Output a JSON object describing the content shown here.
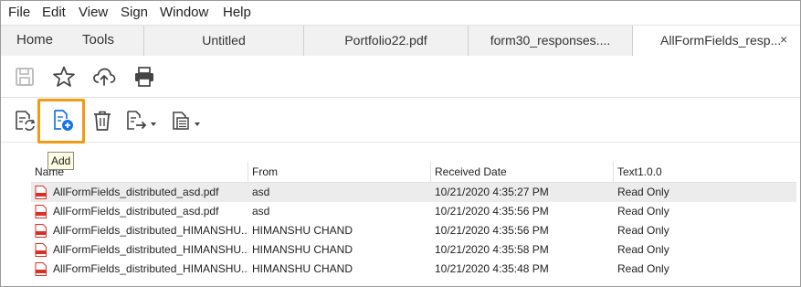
{
  "menu": [
    "File",
    "Edit",
    "View",
    "Sign",
    "Window",
    "Help"
  ],
  "tabs": {
    "home": "Home",
    "tools": "Tools",
    "documents": [
      "Untitled",
      "Portfolio22.pdf",
      "form30_responses....",
      "AllFormFields_resp..."
    ],
    "close": "×"
  },
  "toolbar": {
    "icons": [
      "save-icon",
      "bookmark-star-icon",
      "upload-cloud-icon",
      "print-icon"
    ]
  },
  "responses_toolbar": {
    "icons": [
      "update-icon",
      "add-file-icon",
      "delete-icon",
      "export-icon",
      "export-data-icon"
    ],
    "tooltip": "Add"
  },
  "table": {
    "columns": [
      "Name",
      "From",
      "Received Date",
      "Text1.0.0"
    ],
    "rows": [
      [
        "AllFormFields_distributed_asd.pdf",
        "asd",
        "10/21/2020 4:35:27 PM",
        "Read Only"
      ],
      [
        "AllFormFields_distributed_asd.pdf",
        "asd",
        "10/21/2020 4:35:56 PM",
        "Read Only"
      ],
      [
        "AllFormFields_distributed_HIMANSHU...",
        "HIMANSHU CHAND",
        "10/21/2020 4:35:56 PM",
        "Read Only"
      ],
      [
        "AllFormFields_distributed_HIMANSHU...",
        "HIMANSHU CHAND",
        "10/21/2020 4:35:58 PM",
        "Read Only"
      ],
      [
        "AllFormFields_distributed_HIMANSHU...",
        "HIMANSHU CHAND",
        "10/21/2020 4:35:48 PM",
        "Read Only"
      ]
    ]
  },
  "colors": {
    "highlight": "#f39a14",
    "accent_blue": "#1473e6",
    "pdf_red": "#d93025"
  }
}
